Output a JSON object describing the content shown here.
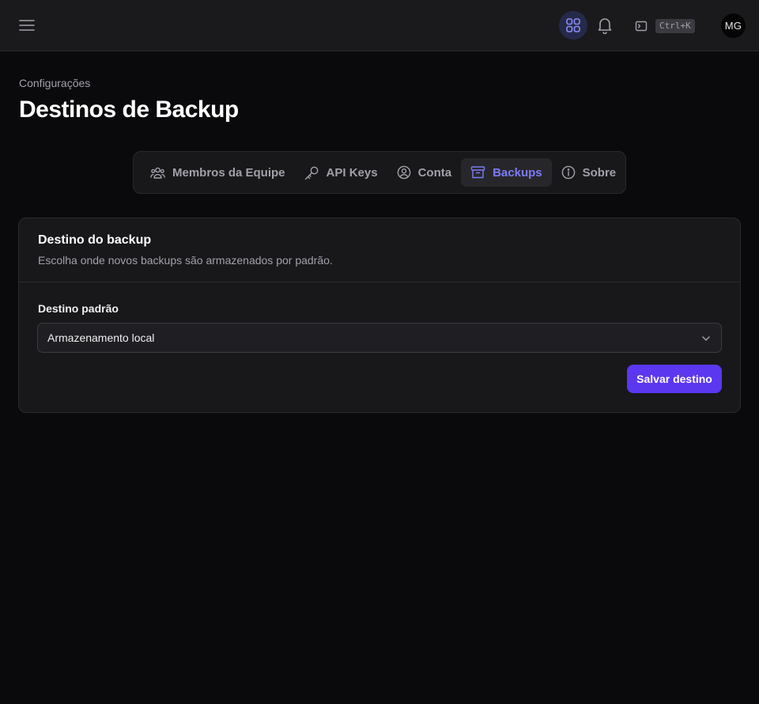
{
  "topbar": {
    "command_shortcut": "Ctrl+K",
    "avatar_initials": "MG",
    "icons": [
      "menu-icon",
      "apps-grid-icon",
      "bell-icon",
      "terminal-icon"
    ]
  },
  "page": {
    "breadcrumb": "Configurações",
    "title": "Destinos de Backup"
  },
  "tabs": [
    {
      "label": "Membros da Equipe",
      "icon": "users-icon",
      "active": false
    },
    {
      "label": "API Keys",
      "icon": "key-icon",
      "active": false
    },
    {
      "label": "Conta",
      "icon": "user-circle-icon",
      "active": false
    },
    {
      "label": "Backups",
      "icon": "archive-icon",
      "active": true
    },
    {
      "label": "Sobre",
      "icon": "info-icon",
      "active": false
    }
  ],
  "card": {
    "title": "Destino do backup",
    "description": "Escolha onde novos backups são armazenados por padrão.",
    "field_label": "Destino padrão",
    "selected_value": "Armazenamento local",
    "save_label": "Salvar destino"
  },
  "colors": {
    "background": "#0a0a0c",
    "surface": "#18181b",
    "accent": "#5b37f0",
    "active_tab_text": "#7c7cf8"
  }
}
